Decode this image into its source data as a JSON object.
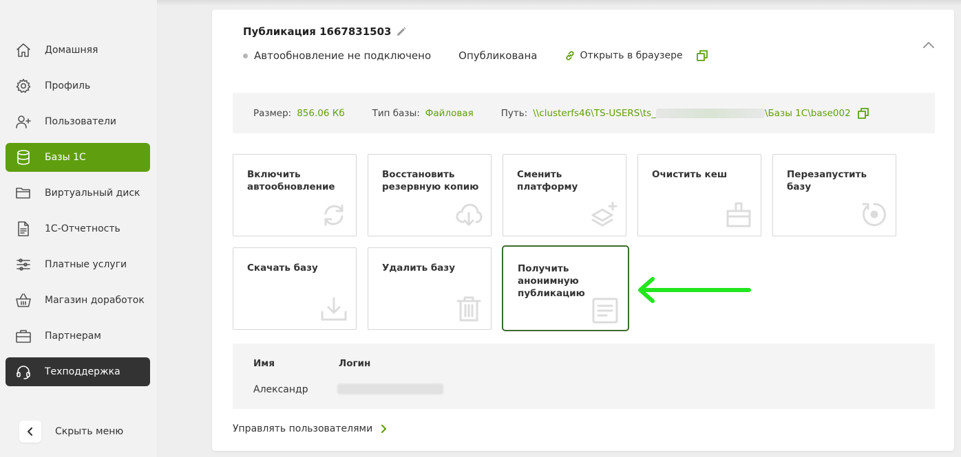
{
  "sidebar": {
    "items": [
      {
        "label": "Домашняя",
        "icon": "home-icon"
      },
      {
        "label": "Профиль",
        "icon": "gear-icon"
      },
      {
        "label": "Пользователи",
        "icon": "user-plus-icon"
      },
      {
        "label": "Базы 1С",
        "icon": "database-icon",
        "state": "active"
      },
      {
        "label": "Виртуальный диск",
        "icon": "folder-icon"
      },
      {
        "label": "1С-Отчетность",
        "icon": "document-icon"
      },
      {
        "label": "Платные услуги",
        "icon": "sliders-icon"
      },
      {
        "label": "Магазин доработок",
        "icon": "basket-icon"
      },
      {
        "label": "Партнерам",
        "icon": "briefcase-icon"
      },
      {
        "label": "Техподдержка",
        "icon": "headset-icon",
        "state": "dark"
      }
    ],
    "hide_menu_label": "Скрыть меню"
  },
  "publication": {
    "title": "Публикация 1667831503",
    "autoupdate_status": "Автообновление не подключено",
    "publish_status": "Опубликована",
    "open_in_browser": "Открыть в браузере"
  },
  "info": {
    "size_label": "Размер:",
    "size_value": "856.06 Кб",
    "type_label": "Тип базы:",
    "type_value": "Файловая",
    "path_label": "Путь:",
    "path_prefix": "\\\\clusterfs46\\TS-USERS\\ts_",
    "path_suffix": "\\Базы 1С\\base002"
  },
  "actions": [
    {
      "label": "Включить автообновление",
      "icon": "refresh-icon"
    },
    {
      "label": "Восстановить резервную копию",
      "icon": "cloud-download-icon"
    },
    {
      "label": "Сменить платформу",
      "icon": "layers-plus-icon"
    },
    {
      "label": "Очистить кеш",
      "icon": "brush-icon"
    },
    {
      "label": "Перезапустить базу",
      "icon": "restart-icon"
    },
    {
      "label": "Скачать базу",
      "icon": "download-icon"
    },
    {
      "label": "Удалить базу",
      "icon": "trash-icon"
    },
    {
      "label": "Получить анонимную публикацию",
      "icon": "notes-icon"
    }
  ],
  "users_table": {
    "headers": [
      "Имя",
      "Логин"
    ],
    "rows": [
      {
        "name": "Александр"
      }
    ]
  },
  "manage_users_label": "Управлять пользователями",
  "colors": {
    "accent": "#5f9f0f",
    "dark": "#333333",
    "highlight_border": "#3d6b2c",
    "arrow": "#22e61e"
  }
}
